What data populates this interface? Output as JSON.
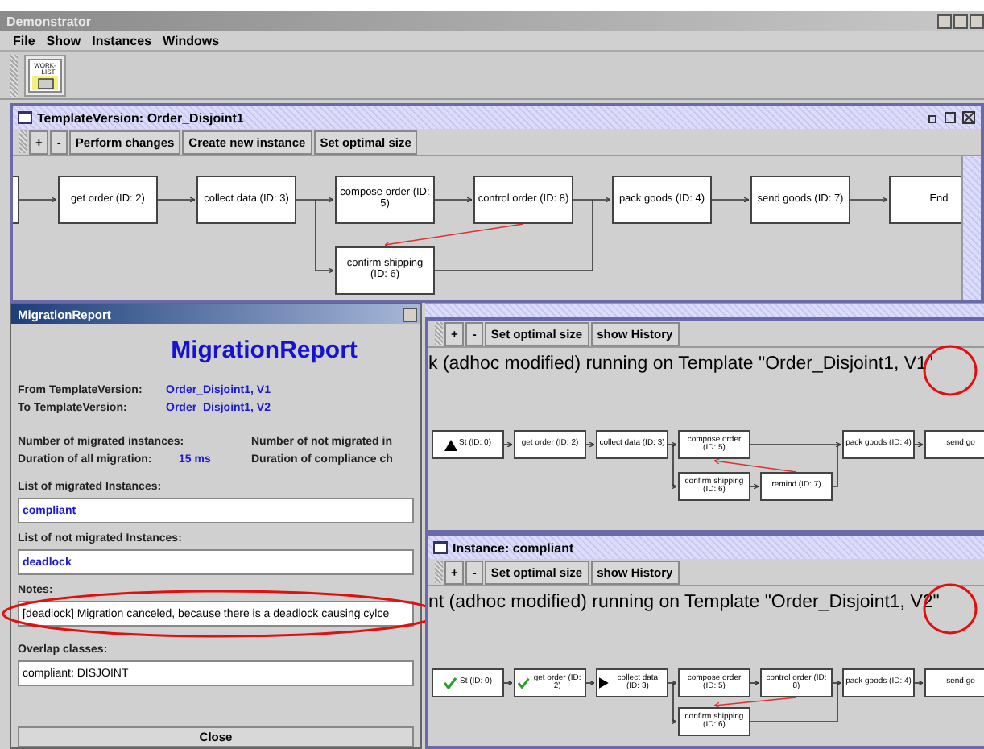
{
  "window": {
    "title": "Demonstrator"
  },
  "menu": [
    {
      "label": "File"
    },
    {
      "label": "Show"
    },
    {
      "label": "Instances"
    },
    {
      "label": "Windows"
    }
  ],
  "toolbar": {
    "worklist_text": [
      "WORK-",
      "LIST"
    ]
  },
  "template_frame": {
    "title": "TemplateVersion: Order_Disjoint1",
    "buttons": [
      "+",
      "-",
      "Perform changes",
      "Create new instance",
      "Set optimal size"
    ],
    "graph": {
      "main": [
        {
          "label": "get order (ID: 2)"
        },
        {
          "label": "collect data (ID: 3)"
        },
        {
          "label": "compose order (ID: 5)"
        },
        {
          "label": "control order (ID: 8)"
        },
        {
          "label": "pack goods (ID: 4)"
        },
        {
          "label": "send goods (ID: 7)"
        },
        {
          "label": "End"
        }
      ],
      "branch": [
        {
          "label": "confirm shipping (ID: 6)"
        }
      ]
    }
  },
  "migration_report": {
    "title": "MigrationReport",
    "heading": "MigrationReport",
    "from_label": "From TemplateVersion:",
    "from_value": "Order_Disjoint1, V1",
    "to_label": "To TemplateVersion:",
    "to_value": "Order_Disjoint1, V2",
    "migrated_count_label": "Number of migrated instances:",
    "not_migrated_count_label": "Number of not migrated in",
    "duration_label": "Duration of all migration:",
    "duration_value": "15 ms",
    "compliance_label": "Duration of compliance ch",
    "migrated_label": "List of migrated Instances:",
    "migrated_value": "compliant",
    "not_migrated_label": "List of not migrated Instances:",
    "not_migrated_value": "deadlock",
    "notes_label": "Notes:",
    "notes_value": "[deadlock] Migration canceled, because there is a deadlock causing cylce",
    "overlap_label": "Overlap classes:",
    "overlap_value": "compliant: DISJOINT",
    "close_button": "Close"
  },
  "instances": [
    {
      "buttons": [
        "+",
        "-",
        "Set optimal size",
        "show History"
      ],
      "heading": "k (adhoc modified)  running on Template \"Order_Disjoint1, V1\"",
      "graph": {
        "main": [
          {
            "label": "St (ID: 0)",
            "activated": true,
            "completed": false,
            "running": false
          },
          {
            "label": "get order (ID: 2)",
            "activated": false,
            "completed": false,
            "running": false
          },
          {
            "label": "collect data (ID: 3)",
            "activated": false,
            "completed": false,
            "running": false
          },
          {
            "label": "compose order (ID: 5)",
            "activated": false,
            "completed": false,
            "running": false
          },
          {
            "label": "pack goods (ID: 4)",
            "activated": false,
            "completed": false,
            "running": false
          },
          {
            "label": "send go",
            "activated": false,
            "completed": false,
            "running": false
          }
        ],
        "branch": [
          {
            "label": "confirm shipping (ID: 6)"
          },
          {
            "label": "remind (ID: 7)"
          }
        ]
      }
    },
    {
      "title": "Instance: compliant",
      "buttons": [
        "+",
        "-",
        "Set optimal size",
        "show History"
      ],
      "heading": "nt (adhoc modified)  running on Template \"Order_Disjoint1, V2\"",
      "graph": {
        "main": [
          {
            "label": "St (ID: 0)",
            "activated": false,
            "completed": true,
            "running": false
          },
          {
            "label": "get order (ID: 2)",
            "activated": false,
            "completed": true,
            "running": false
          },
          {
            "label": "collect data (ID: 3)",
            "activated": false,
            "completed": false,
            "running": true
          },
          {
            "label": "compose order (ID: 5)",
            "activated": false,
            "completed": false,
            "running": false
          },
          {
            "label": "control order (ID: 8)",
            "activated": false,
            "completed": false,
            "running": false
          },
          {
            "label": "pack goods (ID: 4)",
            "activated": false,
            "completed": false,
            "running": false
          },
          {
            "label": "send go",
            "activated": false,
            "completed": false,
            "running": false
          }
        ],
        "branch": [
          {
            "label": "confirm shipping (ID: 6)"
          }
        ]
      }
    }
  ]
}
